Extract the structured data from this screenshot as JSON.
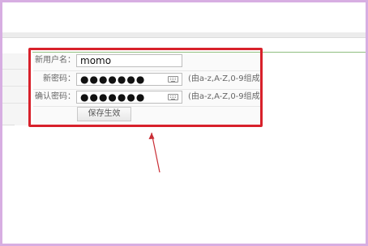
{
  "form": {
    "username": {
      "label": "新用户名：",
      "value": "momo"
    },
    "password": {
      "label": "新密码：",
      "masked_value": "●●●●●●●",
      "hint": "(由a-z,A-Z,0-9组成)"
    },
    "confirm_password": {
      "label": "确认密码：",
      "masked_value": "●●●●●●●",
      "hint": "(由a-z,A-Z,0-9组成)"
    },
    "save_label": "保存生效"
  },
  "annotation": {
    "highlight_color": "#d8212b",
    "arrow_color": "#c92d35"
  },
  "icons": {
    "keyboard": "keyboard-icon"
  }
}
